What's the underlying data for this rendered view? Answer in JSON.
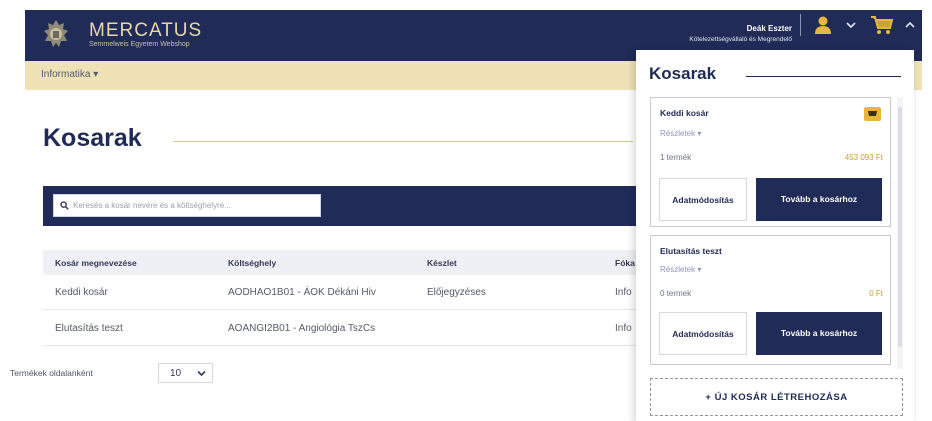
{
  "header": {
    "brand_title": "MERCATUS",
    "brand_subtitle": "Semmelweis Egyetem Webshop",
    "user_name": "Deák Eszter",
    "user_role": "Kötelezettségvállaló és Megrendelő",
    "user_icon": "user-icon",
    "cart_icon": "cart-icon"
  },
  "nav": {
    "category": "Informatika"
  },
  "page": {
    "title": "Kosarak"
  },
  "search": {
    "placeholder": "Keresés a kosár nevére és a költséghelyre..."
  },
  "table": {
    "headers": [
      "Kosár megnevezése",
      "Költséghely",
      "Készlet",
      "Fóka"
    ],
    "rows": [
      [
        "Keddi kosár",
        "AODHAO1B01 - ÁOK Dékáni Hiv",
        "Előjegyzéses",
        "Info"
      ],
      [
        "Elutasítás teszt",
        "AOANGI2B01 - Angiológia TszCs",
        "",
        "Info"
      ]
    ]
  },
  "pagination": {
    "per_page_label": "Termékek oldalanként",
    "per_page_value": "10"
  },
  "cart_panel": {
    "title": "Kosarak",
    "carts": [
      {
        "name": "Keddi kosár",
        "details": "Részletek",
        "count": "1 termék",
        "total": "453 093 Ft",
        "edit_label": "Adatmódosítás",
        "go_label": "Tovább a kosárhoz"
      },
      {
        "name": "Elutasítás teszt",
        "details": "Részletek",
        "count": "0 termek",
        "total": "0 Ft",
        "edit_label": "Adatmódosítás",
        "go_label": "Tovább a kosárhoz"
      }
    ],
    "new_cart_label": "+ ÚJ KOSÁR LÉTREHOZÁSA"
  },
  "colors": {
    "navy": "#202b58",
    "gold": "#efe2b6",
    "accent": "#e7b739"
  }
}
